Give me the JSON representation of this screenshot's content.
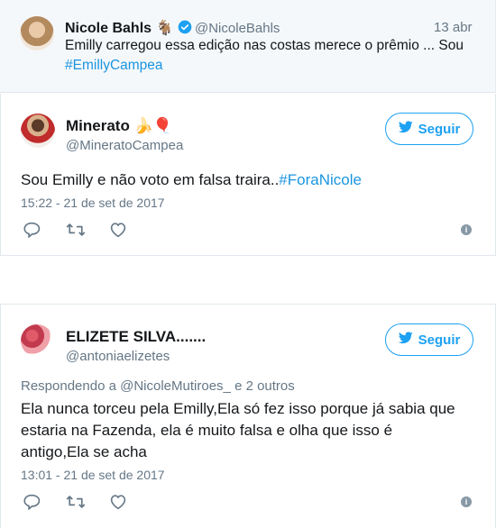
{
  "quoted": {
    "name": "Nicole Bahls",
    "emoji": "🐐",
    "handle": "@NicoleBahls",
    "date": "13 abr",
    "text": "Emilly carregou essa edição nas costas merece o prêmio ... Sou",
    "hashtag": "#EmillyCampea"
  },
  "tweet1": {
    "name": "Minerato",
    "emoji": "🍌🎈",
    "handle": "@MineratoCampea",
    "follow_label": "Seguir",
    "text": "Sou Emilly e não voto em falsa traira..",
    "hashtag": "#ForaNicole",
    "timestamp": "15:22 - 21 de set de 2017"
  },
  "tweet2": {
    "name": "ELIZETE SILVA.......",
    "handle": "@antoniaelizetes",
    "follow_label": "Seguir",
    "reply_prefix": "Respondendo a",
    "reply_handle": "@NicoleMutiroes_",
    "reply_suffix": "e 2 outros",
    "text_line1": "Ela nunca torceu pela Emilly,Ela só fez isso porque já sabia que",
    "text_line2": "estaria na Fazenda, ela é muito falsa e olha que isso é",
    "text_line3": "antigo,Ela se acha",
    "timestamp": "13:01 - 21 de set de 2017"
  },
  "icons": [
    "verified-icon",
    "twitter-bird-icon",
    "reply-icon",
    "retweet-icon",
    "like-icon",
    "info-icon"
  ],
  "colors": {
    "link": "#1b95e0",
    "brand": "#1da1f2",
    "muted": "#657786",
    "verified": "#1da1f2"
  }
}
